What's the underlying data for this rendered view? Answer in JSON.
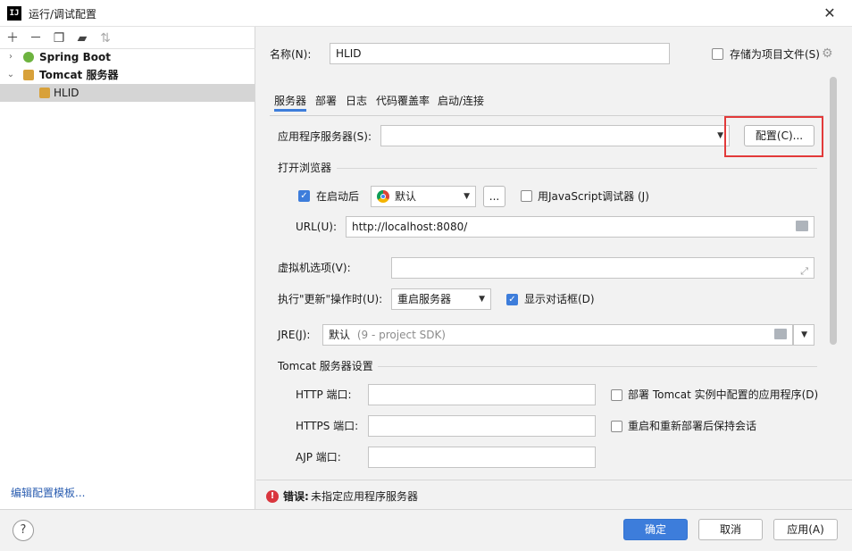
{
  "window": {
    "title": "运行/调试配置",
    "app_icon": "IJ"
  },
  "tree": {
    "items": [
      {
        "label": "Spring Boot",
        "bold": true
      },
      {
        "label": "Tomcat 服务器",
        "bold": true
      },
      {
        "label": "HLID",
        "bold": false
      }
    ],
    "edit_templates": "编辑配置模板..."
  },
  "form": {
    "name_label": "名称(N):",
    "name_value": "HLID",
    "store_as_project": "存储为项目文件(S)",
    "tabs": [
      "服务器",
      "部署",
      "日志",
      "代码覆盖率",
      "启动/连接"
    ],
    "app_server_label": "应用程序服务器(S):",
    "app_server_value": "",
    "configure_button": "配置(C)...",
    "open_browser_section": "打开浏览器",
    "after_launch": "在启动后",
    "browser_value": "默认",
    "browse_button": "...",
    "js_debugger": "用JavaScript调试器 (J)",
    "url_label": "URL(U):",
    "url_value": "http://localhost:8080/",
    "vm_options_label": "虚拟机选项(V):",
    "vm_options_value": "",
    "on_update_label": "执行\"更新\"操作时(U):",
    "on_update_value": "重启服务器",
    "show_dialog": "显示对话框(D)",
    "jre_label": "JRE(J):",
    "jre_value": "默认",
    "jre_hint": "(9 - project SDK)",
    "tomcat_section": "Tomcat 服务器设置",
    "http_port_label": "HTTP 端口:",
    "https_port_label": "HTTPS 端口:",
    "ajp_port_label": "AJP 端口:",
    "deploy_apps": "部署 Tomcat 实例中配置的应用程序(D)",
    "preserve_sessions": "重启和重新部署后保持会话"
  },
  "error": {
    "prefix": "错误:",
    "message": "未指定应用程序服务器"
  },
  "buttons": {
    "ok": "确定",
    "cancel": "取消",
    "apply": "应用(A)",
    "help": "?"
  },
  "colors": {
    "accent": "#3d7ddb",
    "highlight": "#e23a3a",
    "error": "#d9363e"
  }
}
